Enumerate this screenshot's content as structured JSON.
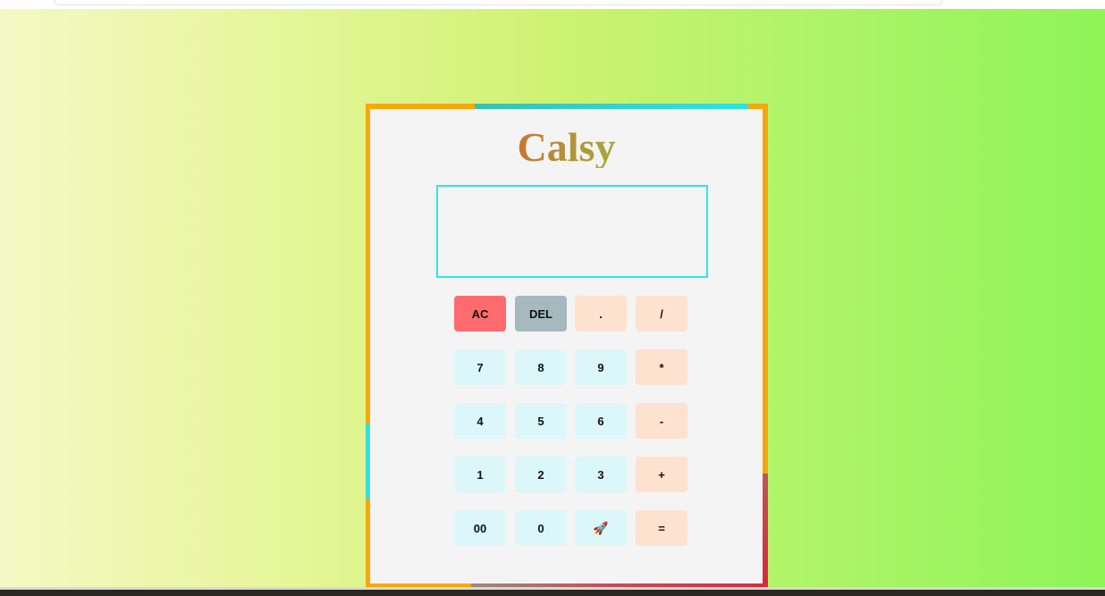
{
  "app": {
    "title": "Calsy"
  },
  "display": {
    "value": ""
  },
  "keys": {
    "row1": [
      "AC",
      "DEL",
      ".",
      "/"
    ],
    "row2": [
      "7",
      "8",
      "9",
      "*"
    ],
    "row3": [
      "4",
      "5",
      "6",
      "-"
    ],
    "row4": [
      "1",
      "2",
      "3",
      "+"
    ],
    "row5": [
      "00",
      "0",
      "🚀",
      "="
    ]
  },
  "icons": {
    "rocket": "rocket-icon"
  },
  "colors": {
    "frame": "#f7a708",
    "display_border": "#2ee6e6",
    "ac": "#ff6b6e",
    "del": "#a5b9bf",
    "number_key": "#dcf7fa",
    "operator_key": "#fde2cf"
  }
}
